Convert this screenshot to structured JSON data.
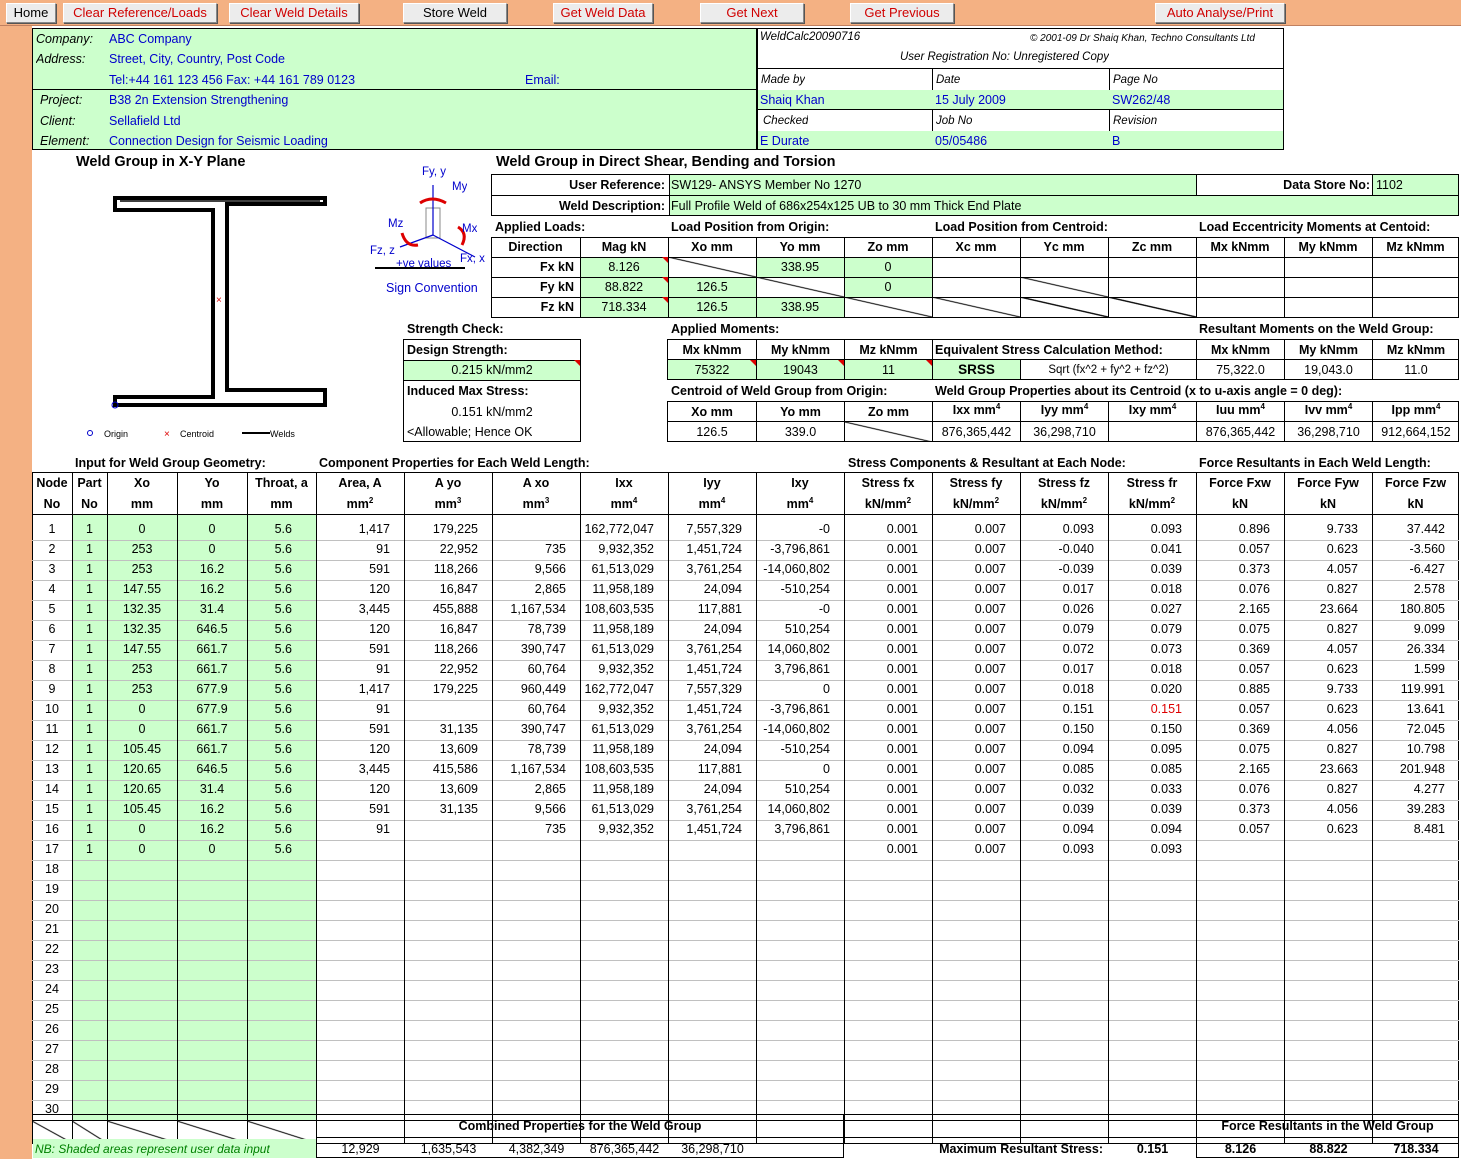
{
  "toolbar": {
    "home": "Home",
    "clear_ref": "Clear Reference/Loads",
    "clear_weld": "Clear Weld Details",
    "store": "Store Weld",
    "get_data": "Get Weld Data",
    "get_next": "Get Next",
    "get_prev": "Get Previous",
    "auto": "Auto Analyse/Print"
  },
  "header": {
    "company_label": "Company:",
    "company": "ABC Company",
    "address_label": "Address:",
    "address": "Street, City, Country, Post Code",
    "tel": "Tel:+44 161 123 456  Fax: +44 161 789 0123",
    "email_label": "Email:",
    "project_label": "Project:",
    "project": "B38 2n Extension Strengthening",
    "client_label": "Client:",
    "client": "Sellafield Ltd",
    "element_label": "Element:",
    "element": "Connection Design for Seismic Loading",
    "program": "WeldCalc20090716",
    "copyright": "© 2001-09 Dr Shaiq Khan, Techno Consultants Ltd",
    "registration": "User Registration No:  Unregistered Copy",
    "made_by_label": "Made by",
    "made_by": "Shaiq Khan",
    "date_label": "Date",
    "date": "15 July 2009",
    "page_label": "Page No",
    "page": "SW262/48",
    "checked_label": "Checked",
    "checked": "E Durate",
    "job_label": "Job No",
    "job": "05/05486",
    "revision_label": "Revision",
    "revision": "B"
  },
  "diagram": {
    "title": "Weld Group in X-Y Plane",
    "legend_origin": "Origin",
    "legend_centroid": "Centroid",
    "legend_welds": "Welds",
    "fy": "Fy, y",
    "my": "My",
    "mz": "Mz",
    "mx": "Mx",
    "fz": "Fz, z",
    "fx": "Fx, x",
    "ve": "+ve values",
    "sign": "Sign Convention"
  },
  "shear": {
    "title": "Weld Group in Direct Shear, Bending and Torsion",
    "user_ref_label": "User Reference:",
    "user_ref": "SW129- ANSYS Member No 1270",
    "datastore_label": "Data Store No:",
    "datastore": "1102",
    "desc_label": "Weld Description:",
    "desc": "Full Profile Weld of 686x254x125 UB to 30 mm Thick End Plate",
    "applied_loads": "Applied Loads:",
    "load_pos": "Load Position from Origin:",
    "load_cent": "Load Position from Centroid:",
    "ecc": "Load Eccentricity Moments at Centoid:",
    "heads": [
      "Direction",
      "Mag kN",
      "Xo mm",
      "Yo mm",
      "Zo mm",
      "Xc mm",
      "Yc mm",
      "Zc mm",
      "Mx kNmm",
      "My kNmm",
      "Mz kNmm"
    ],
    "fx_label": "Fx kN",
    "fx_mag": "8.126",
    "fx_yo": "338.95",
    "fx_zo": "0",
    "fy_label": "Fy kN",
    "fy_mag": "88.822",
    "fy_xo": "126.5",
    "fy_zo": "0",
    "fz_label": "Fz kN",
    "fz_mag": "718.334",
    "fz_xo": "126.5",
    "fz_yo": "338.95"
  },
  "strength": {
    "check": "Strength Check:",
    "design_label": "Design Strength:",
    "design": "0.215 kN/mm2",
    "induced_label": "Induced Max Stress:",
    "induced": "0.151 kN/mm2",
    "ok": "<Allowable; Hence OK"
  },
  "moments": {
    "applied": "Applied Moments:",
    "mx_h": "Mx kNmm",
    "my_h": "My kNmm",
    "mz_h": "Mz kNmm",
    "mx": "75322",
    "my": "19043",
    "mz": "11",
    "eq_label": "Equivalent Stress Calculation Method:",
    "srss": "SRSS",
    "formula": "Sqrt (fx^2 + fy^2 + fz^2)",
    "res_label": "Resultant Moments on the Weld Group:",
    "rmx": "75,322.0",
    "rmy": "19,043.0",
    "rmz": "11.0",
    "centroid_label": "Centroid of Weld Group from Origin:",
    "xo_h": "Xo mm",
    "yo_h": "Yo mm",
    "zo_h": "Zo mm",
    "cxo": "126.5",
    "cyo": "339.0",
    "props_label": "Weld Group Properties about its Centroid (x to u-axis angle = 0 deg):",
    "ixx_h": "Ixx mm",
    "iyy_h": "Iyy mm",
    "ixy_h": "Ixy mm",
    "iuu_h": "Iuu mm",
    "ivv_h": "Ivv mm",
    "ipp_h": "Ipp mm",
    "ixx": "876,365,442",
    "iyy": "36,298,710",
    "iuu": "876,365,442",
    "ivv": "36,298,710",
    "ipp": "912,664,152"
  },
  "table": {
    "sec_input": "Input for Weld Group Geometry:",
    "sec_comp": "Component Properties for Each Weld Length:",
    "sec_stress": "Stress Components & Resultant at Each Node:",
    "sec_force": "Force Resultants in Each Weld Length:",
    "h1": [
      "Node",
      "Part",
      "Xo",
      "Yo",
      "Throat, a",
      "Area, A",
      "A yo",
      "A xo",
      "Ixx",
      "Iyy",
      "Ixy",
      "Stress fx",
      "Stress fy",
      "Stress fz",
      "Stress fr",
      "Force Fxw",
      "Force Fyw",
      "Force Fzw"
    ],
    "h2": [
      "No",
      "No",
      "mm",
      "mm",
      "mm",
      "mm",
      "mm",
      "mm",
      "mm",
      "mm",
      "mm",
      "kN/mm",
      "kN/mm",
      "kN/mm",
      "kN/mm",
      "kN",
      "kN",
      "kN"
    ],
    "h2sup": [
      "",
      "",
      "",
      "",
      "",
      "2",
      "3",
      "3",
      "4",
      "4",
      "4",
      "2",
      "2",
      "2",
      "2",
      "",
      "",
      ""
    ],
    "rows": [
      [
        "1",
        "1",
        "0",
        "0",
        "5.6",
        "1,417",
        "179,225",
        "",
        "162,772,047",
        "7,557,329",
        "-0",
        "0.001",
        "0.007",
        "0.093",
        "0.093",
        "0.896",
        "9.733",
        "37.442"
      ],
      [
        "2",
        "1",
        "253",
        "0",
        "5.6",
        "91",
        "22,952",
        "735",
        "9,932,352",
        "1,451,724",
        "-3,796,861",
        "0.001",
        "0.007",
        "-0.040",
        "0.041",
        "0.057",
        "0.623",
        "-3.560"
      ],
      [
        "3",
        "1",
        "253",
        "16.2",
        "5.6",
        "591",
        "118,266",
        "9,566",
        "61,513,029",
        "3,761,254",
        "-14,060,802",
        "0.001",
        "0.007",
        "-0.039",
        "0.039",
        "0.373",
        "4.057",
        "-6.427"
      ],
      [
        "4",
        "1",
        "147.55",
        "16.2",
        "5.6",
        "120",
        "16,847",
        "2,865",
        "11,958,189",
        "24,094",
        "-510,254",
        "0.001",
        "0.007",
        "0.017",
        "0.018",
        "0.076",
        "0.827",
        "2.578"
      ],
      [
        "5",
        "1",
        "132.35",
        "31.4",
        "5.6",
        "3,445",
        "455,888",
        "1,167,534",
        "108,603,535",
        "117,881",
        "-0",
        "0.001",
        "0.007",
        "0.026",
        "0.027",
        "2.165",
        "23.664",
        "180.805"
      ],
      [
        "6",
        "1",
        "132.35",
        "646.5",
        "5.6",
        "120",
        "16,847",
        "78,739",
        "11,958,189",
        "24,094",
        "510,254",
        "0.001",
        "0.007",
        "0.079",
        "0.079",
        "0.075",
        "0.827",
        "9.099"
      ],
      [
        "7",
        "1",
        "147.55",
        "661.7",
        "5.6",
        "591",
        "118,266",
        "390,747",
        "61,513,029",
        "3,761,254",
        "14,060,802",
        "0.001",
        "0.007",
        "0.072",
        "0.073",
        "0.369",
        "4.057",
        "26.334"
      ],
      [
        "8",
        "1",
        "253",
        "661.7",
        "5.6",
        "91",
        "22,952",
        "60,764",
        "9,932,352",
        "1,451,724",
        "3,796,861",
        "0.001",
        "0.007",
        "0.017",
        "0.018",
        "0.057",
        "0.623",
        "1.599"
      ],
      [
        "9",
        "1",
        "253",
        "677.9",
        "5.6",
        "1,417",
        "179,225",
        "960,449",
        "162,772,047",
        "7,557,329",
        "0",
        "0.001",
        "0.007",
        "0.018",
        "0.020",
        "0.885",
        "9.733",
        "119.991"
      ],
      [
        "10",
        "1",
        "0",
        "677.9",
        "5.6",
        "91",
        "",
        "60,764",
        "9,932,352",
        "1,451,724",
        "-3,796,861",
        "0.001",
        "0.007",
        "0.151",
        "0.151",
        "0.057",
        "0.623",
        "13.641"
      ],
      [
        "11",
        "1",
        "0",
        "661.7",
        "5.6",
        "591",
        "31,135",
        "390,747",
        "61,513,029",
        "3,761,254",
        "-14,060,802",
        "0.001",
        "0.007",
        "0.150",
        "0.150",
        "0.369",
        "4.056",
        "72.045"
      ],
      [
        "12",
        "1",
        "105.45",
        "661.7",
        "5.6",
        "120",
        "13,609",
        "78,739",
        "11,958,189",
        "24,094",
        "-510,254",
        "0.001",
        "0.007",
        "0.094",
        "0.095",
        "0.075",
        "0.827",
        "10.798"
      ],
      [
        "13",
        "1",
        "120.65",
        "646.5",
        "5.6",
        "3,445",
        "415,586",
        "1,167,534",
        "108,603,535",
        "117,881",
        "0",
        "0.001",
        "0.007",
        "0.085",
        "0.085",
        "2.165",
        "23.663",
        "201.948"
      ],
      [
        "14",
        "1",
        "120.65",
        "31.4",
        "5.6",
        "120",
        "13,609",
        "2,865",
        "11,958,189",
        "24,094",
        "510,254",
        "0.001",
        "0.007",
        "0.032",
        "0.033",
        "0.076",
        "0.827",
        "4.277"
      ],
      [
        "15",
        "1",
        "105.45",
        "16.2",
        "5.6",
        "591",
        "31,135",
        "9,566",
        "61,513,029",
        "3,761,254",
        "14,060,802",
        "0.001",
        "0.007",
        "0.039",
        "0.039",
        "0.373",
        "4.056",
        "39.283"
      ],
      [
        "16",
        "1",
        "0",
        "16.2",
        "5.6",
        "91",
        "",
        "735",
        "9,932,352",
        "1,451,724",
        "3,796,861",
        "0.001",
        "0.007",
        "0.094",
        "0.094",
        "0.057",
        "0.623",
        "8.481"
      ],
      [
        "17",
        "1",
        "0",
        "0",
        "5.6",
        "",
        "",
        "",
        "",
        "",
        "",
        "0.001",
        "0.007",
        "0.093",
        "0.093",
        "",
        "",
        ""
      ],
      [
        "18",
        "",
        "",
        "",
        "",
        "",
        "",
        "",
        "",
        "",
        "",
        "",
        "",
        "",
        "",
        "",
        "",
        ""
      ],
      [
        "19",
        "",
        "",
        "",
        "",
        "",
        "",
        "",
        "",
        "",
        "",
        "",
        "",
        "",
        "",
        "",
        "",
        ""
      ],
      [
        "20",
        "",
        "",
        "",
        "",
        "",
        "",
        "",
        "",
        "",
        "",
        "",
        "",
        "",
        "",
        "",
        "",
        ""
      ],
      [
        "21",
        "",
        "",
        "",
        "",
        "",
        "",
        "",
        "",
        "",
        "",
        "",
        "",
        "",
        "",
        "",
        "",
        ""
      ],
      [
        "22",
        "",
        "",
        "",
        "",
        "",
        "",
        "",
        "",
        "",
        "",
        "",
        "",
        "",
        "",
        "",
        "",
        ""
      ],
      [
        "23",
        "",
        "",
        "",
        "",
        "",
        "",
        "",
        "",
        "",
        "",
        "",
        "",
        "",
        "",
        "",
        "",
        ""
      ],
      [
        "24",
        "",
        "",
        "",
        "",
        "",
        "",
        "",
        "",
        "",
        "",
        "",
        "",
        "",
        "",
        "",
        "",
        ""
      ],
      [
        "25",
        "",
        "",
        "",
        "",
        "",
        "",
        "",
        "",
        "",
        "",
        "",
        "",
        "",
        "",
        "",
        "",
        ""
      ],
      [
        "26",
        "",
        "",
        "",
        "",
        "",
        "",
        "",
        "",
        "",
        "",
        "",
        "",
        "",
        "",
        "",
        "",
        ""
      ],
      [
        "27",
        "",
        "",
        "",
        "",
        "",
        "",
        "",
        "",
        "",
        "",
        "",
        "",
        "",
        "",
        "",
        "",
        ""
      ],
      [
        "28",
        "",
        "",
        "",
        "",
        "",
        "",
        "",
        "",
        "",
        "",
        "",
        "",
        "",
        "",
        "",
        "",
        ""
      ],
      [
        "29",
        "",
        "",
        "",
        "",
        "",
        "",
        "",
        "",
        "",
        "",
        "",
        "",
        "",
        "",
        "",
        "",
        ""
      ],
      [
        "30",
        "",
        "",
        "",
        "",
        "",
        "",
        "",
        "",
        "",
        "",
        "",
        "",
        "",
        "",
        "",
        "",
        ""
      ]
    ],
    "highlight_red": "0.151"
  },
  "footer": {
    "nb": "NB: Shaded areas represent user data input",
    "combined": "Combined Properties for the Weld Group",
    "area": "12,929",
    "ayo": "1,635,543",
    "axo": "4,382,349",
    "ixx": "876,365,442",
    "iyy": "36,298,710",
    "max_label": "Maximum Resultant Stress:",
    "max": "0.151",
    "force_label": "Force Resultants in the Weld Group",
    "fx": "8.126",
    "fy": "88.822",
    "fz": "718.334"
  }
}
